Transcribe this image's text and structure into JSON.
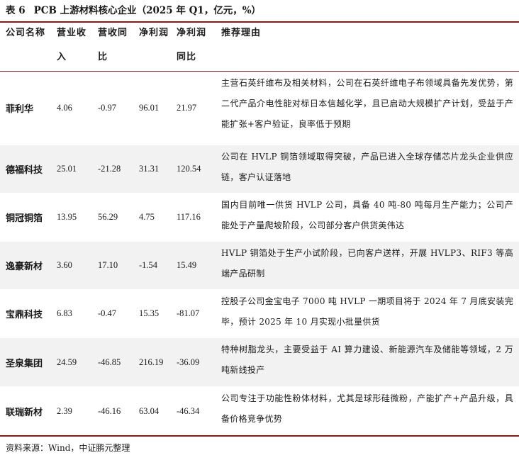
{
  "table": {
    "label": "表 6",
    "title": "PCB 上游材料核心企业（2025 年 Q1，亿元，%）",
    "columns": [
      "公司名称",
      "营业收入",
      "营收同比",
      "净利润",
      "净利润同比",
      "推荐理由"
    ],
    "rows": [
      {
        "company": "菲利华",
        "revenue": "4.06",
        "revenue_yoy": "-0.97",
        "net_profit": "96.01",
        "profit_yoy": "21.97",
        "reason": "主营石英纤维布及相关材料，公司在石英纤维电子布领域具备先发优势，第二代产品介电性能对标日本信越化学，且已启动大规模扩产计划，受益于产能扩张+客户验证，良率低于预期"
      },
      {
        "company": "德福科技",
        "revenue": "25.01",
        "revenue_yoy": "-21.28",
        "net_profit": "31.31",
        "profit_yoy": "120.54",
        "reason": "公司在 HVLP 铜箔领域取得突破，产品已进入全球存储芯片龙头企业供应链，客户认证落地"
      },
      {
        "company": "铜冠铜箔",
        "revenue": "13.95",
        "revenue_yoy": "56.29",
        "net_profit": "4.75",
        "profit_yoy": "117.16",
        "reason": "国内目前唯一供货 HVLP 公司，具备 40 吨-80 吨每月生产能力；公司产能处于产量爬坡阶段，公司部分客户供货英伟达"
      },
      {
        "company": "逸豪新材",
        "revenue": "3.60",
        "revenue_yoy": "17.10",
        "net_profit": "-1.54",
        "profit_yoy": "15.49",
        "reason": "HVLP 铜箔处于生产小试阶段，已向客户送样，开展 HVLP3、RIF3 等高端产品研制"
      },
      {
        "company": "宝鼎科技",
        "revenue": "6.83",
        "revenue_yoy": "-0.47",
        "net_profit": "15.35",
        "profit_yoy": "-81.07",
        "reason": "控股子公司金宝电子 7000 吨 HVLP 一期项目将于 2024 年 7 月底安装完毕，预计 2025 年 10 月实现小批量供货"
      },
      {
        "company": "圣泉集团",
        "revenue": "24.59",
        "revenue_yoy": "-46.85",
        "net_profit": "216.19",
        "profit_yoy": "-36.09",
        "reason": "特种树脂龙头，主要受益于 AI 算力建设、新能源汽车及储能等领域，2 万吨新线投产"
      },
      {
        "company": "联瑞新材",
        "revenue": "2.39",
        "revenue_yoy": "-46.16",
        "net_profit": "63.04",
        "profit_yoy": "-46.34",
        "reason": "公司专注于功能性粉体材料，尤其是球形硅微粉，产能扩产+产品升级，具备价格竞争优势"
      }
    ]
  },
  "source": "资料来源：Wind，中证鹏元整理"
}
